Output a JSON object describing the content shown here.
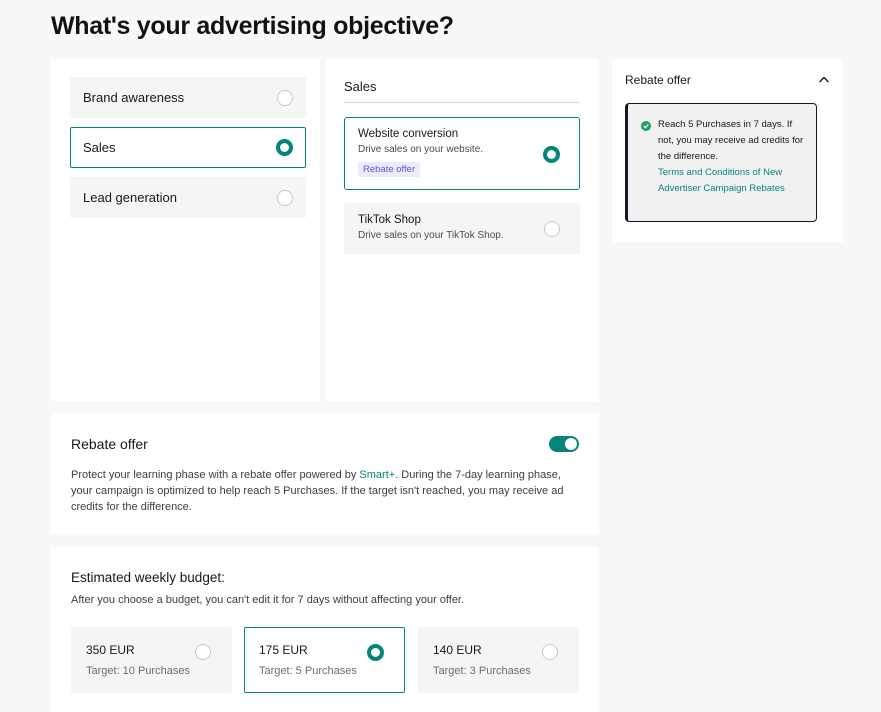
{
  "page": {
    "title": "What's your advertising objective?"
  },
  "objectives": [
    {
      "label": "Brand awareness",
      "selected": false
    },
    {
      "label": "Sales",
      "selected": true
    },
    {
      "label": "Lead generation",
      "selected": false
    }
  ],
  "sales": {
    "header": "Sales",
    "options": [
      {
        "title": "Website conversion",
        "desc": "Drive sales on your website.",
        "tag": "Rebate offer",
        "selected": true
      },
      {
        "title": "TikTok Shop",
        "desc": "Drive sales on your TikTok Shop.",
        "selected": false
      }
    ]
  },
  "side_panel": {
    "title": "Rebate offer",
    "text": "Reach 5 Purchases in 7 days. If not, you may receive ad credits for the difference.",
    "link": "Terms and Conditions of New Advertiser Campaign Rebates",
    "check_icon": "check-circle-icon",
    "collapse_icon": "chevron-up-icon"
  },
  "rebate": {
    "title": "Rebate offer",
    "toggle_on": true,
    "text_before": "Protect your learning phase with a rebate offer powered by ",
    "smart_link": "Smart+",
    "text_after": ". During the 7-day learning phase, your campaign is optimized to help reach 5 Purchases. If the target isn't reached, you may receive ad credits for the difference."
  },
  "budget": {
    "title": "Estimated weekly budget:",
    "subtitle": "After you choose a budget, you can't edit it for 7 days without affecting your offer.",
    "options": [
      {
        "amount": "350 EUR",
        "target": "Target: 10 Purchases",
        "selected": false
      },
      {
        "amount": "175 EUR",
        "target": "Target: 5 Purchases",
        "selected": true
      },
      {
        "amount": "140 EUR",
        "target": "Target: 3 Purchases",
        "selected": false
      }
    ]
  },
  "colors": {
    "accent": "#05857a",
    "tag_bg": "#ecebfb",
    "tag_text": "#5b5cd6",
    "check": "#1da364"
  }
}
